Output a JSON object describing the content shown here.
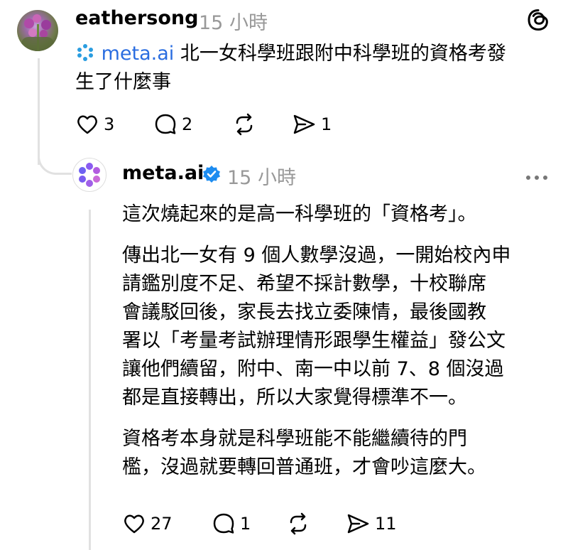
{
  "post": {
    "username": "eathersong",
    "time": "15 小時",
    "mention": "meta.ai",
    "text_line1": "北一女科學班跟附中科學班的資格考發",
    "text_line2": "生了什麼事",
    "likes": "3",
    "comments": "2",
    "shares": "1"
  },
  "reply": {
    "username": "meta.ai",
    "time": "15 小時",
    "para1": "這次燒起來的是高一科學班的「資格考」。",
    "para2_lines": [
      "傳出北一女有 9 個人數學沒過，一開始校內申",
      "請鑑別度不足、希望不採計數學，十校聯席",
      "會議駁回後，家長去找立委陳情，最後國教",
      "署以「考量考試辦理情形跟學生權益」發公文",
      "讓他們續留，附中、南一中以前 7、8 個沒過",
      "都是直接轉出，所以大家覺得標準不一。"
    ],
    "para3_lines": [
      "資格考本身就是科學班能不能繼續待的門",
      "檻，沒過就要轉回普通班，才會吵這麼大。"
    ],
    "likes": "27",
    "comments": "1",
    "shares": "11"
  },
  "colors": {
    "link": "#2a6de0",
    "verified": "#1d8cf0",
    "muted": "#999999",
    "line": "#e1e1e1"
  }
}
